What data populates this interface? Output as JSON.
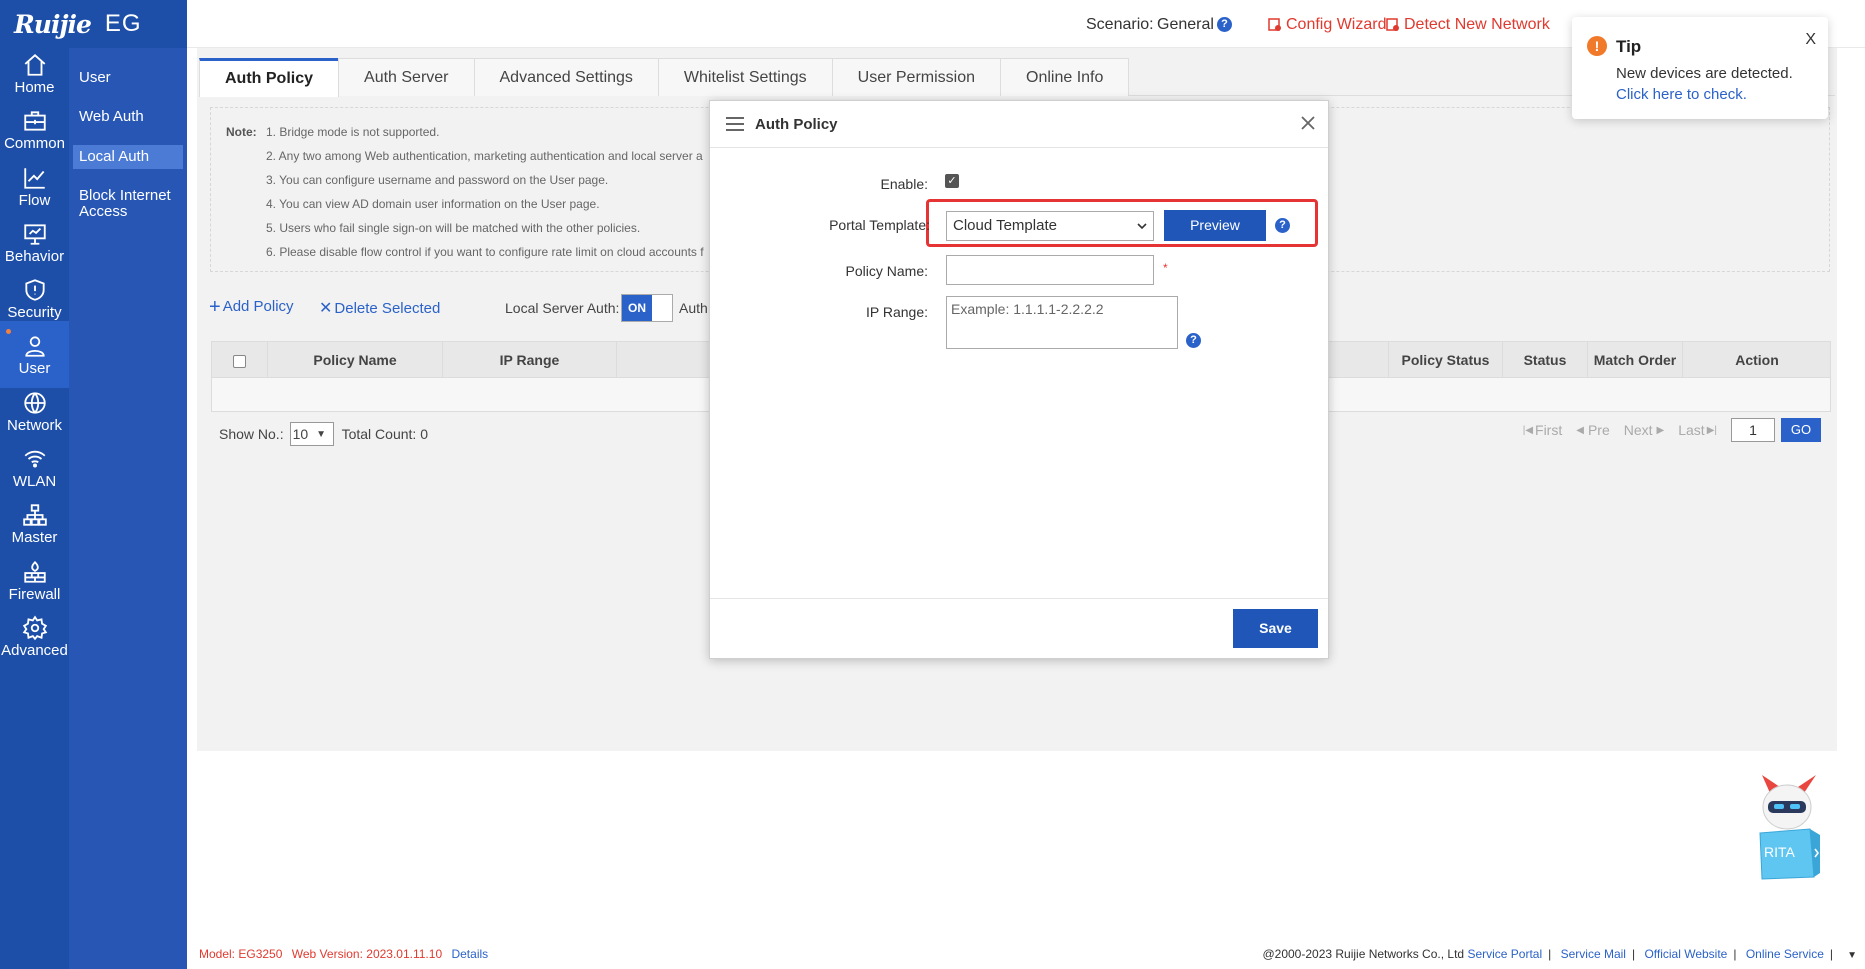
{
  "brand": {
    "logo": "Ruijie",
    "product": "EG"
  },
  "rail": [
    {
      "id": "home",
      "label": "Home",
      "icon": "home-icon"
    },
    {
      "id": "common",
      "label": "Common",
      "icon": "briefcase-icon"
    },
    {
      "id": "flow",
      "label": "Flow",
      "icon": "line-chart-icon"
    },
    {
      "id": "behavior",
      "label": "Behavior",
      "icon": "monitor-icon"
    },
    {
      "id": "security",
      "label": "Security",
      "icon": "shield-icon"
    },
    {
      "id": "user",
      "label": "User",
      "icon": "user-icon",
      "active": true
    },
    {
      "id": "network",
      "label": "Network",
      "icon": "globe-icon"
    },
    {
      "id": "wlan",
      "label": "WLAN",
      "icon": "wifi-icon"
    },
    {
      "id": "master",
      "label": "Master",
      "icon": "hierarchy-icon"
    },
    {
      "id": "firewall",
      "label": "Firewall",
      "icon": "firewall-icon"
    },
    {
      "id": "advanced",
      "label": "Advanced",
      "icon": "gear-icon"
    }
  ],
  "subnav": [
    "User",
    "Web Auth",
    "Local Auth",
    "Block Internet Access"
  ],
  "topbar": {
    "scenario_label": "Scenario:",
    "scenario_value": "General",
    "config_wizard": "Config Wizard",
    "detect_network": "Detect New Network"
  },
  "tabs": [
    "Auth Policy",
    "Auth Server",
    "Advanced Settings",
    "Whitelist Settings",
    "User Permission",
    "Online Info"
  ],
  "notes": {
    "label": "Note:",
    "lines": [
      "1. Bridge mode is not supported.",
      "2. Any two among Web authentication, marketing authentication and local server a",
      "3. You can configure username and password on the User page.",
      "4. You can view AD domain user information on the User page.",
      "5. Users who fail single sign-on will be matched with the other policies.",
      "6. Please disable flow control if you want to configure rate limit on cloud accounts f"
    ]
  },
  "toolbar": {
    "add_policy": "Add Policy",
    "delete_selected": "Delete Selected",
    "local_server_auth": "Local Server Auth:",
    "toggle_on": "ON",
    "auth_truncated": "Auth"
  },
  "table": {
    "headers": [
      "Policy Name",
      "IP Range",
      "Policy Status",
      "Status",
      "Match Order",
      "Action"
    ]
  },
  "pager": {
    "show_no": "Show No.:",
    "page_size": "10",
    "total_count": "Total Count: 0",
    "first": "First",
    "pre": "Pre",
    "next": "Next",
    "last": "Last",
    "page": "1",
    "go": "GO"
  },
  "modal": {
    "title": "Auth Policy",
    "enable_label": "Enable:",
    "portal_template_label": "Portal Template:",
    "portal_template_value": "Cloud Template",
    "preview": "Preview",
    "policy_name_label": "Policy Name:",
    "required_mark": "*",
    "ip_range_label": "IP Range:",
    "ip_range_placeholder": "Example: 1.1.1.1-2.2.2.2",
    "save": "Save"
  },
  "tip": {
    "title": "Tip",
    "message": "New devices are detected.",
    "link": "Click here to check.",
    "close": "X"
  },
  "rita": {
    "label": "RITA"
  },
  "footer": {
    "model_label": "Model:",
    "model_value": "EG3250",
    "web_version_label": "Web Version:",
    "web_version_value": "2023.01.11.10",
    "details": "Details",
    "copyright": "@2000-2023 Ruijie Networks Co., Ltd",
    "service_portal": "Service Portal",
    "service_mail": "Service Mail",
    "official_website": "Official Website",
    "online_service": "Online Service"
  },
  "colors": {
    "rail": "#1d4fa8",
    "subnav": "#2756b5",
    "accent": "#2b62c9",
    "alert": "#e03a2f",
    "highlight": "#e63434"
  }
}
